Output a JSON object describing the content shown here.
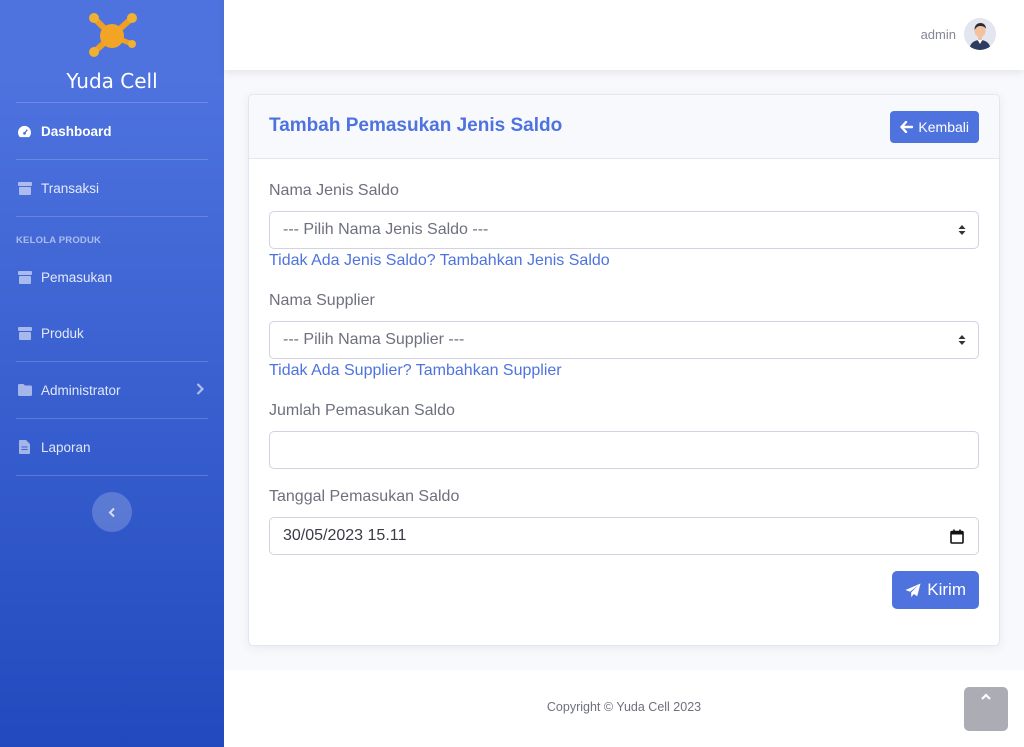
{
  "sidebar": {
    "brand": "Yuda Cell",
    "section_heading": "KELOLA PRODUK",
    "items": [
      {
        "label": "Dashboard",
        "icon": "tachometer-icon"
      },
      {
        "label": "Transaksi",
        "icon": "box-icon"
      },
      {
        "label": "Pemasukan",
        "icon": "box-icon"
      },
      {
        "label": "Produk",
        "icon": "box-icon"
      },
      {
        "label": "Administrator",
        "icon": "folder-icon"
      },
      {
        "label": "Laporan",
        "icon": "file-icon"
      }
    ]
  },
  "topbar": {
    "username": "admin"
  },
  "form": {
    "title": "Tambah Pemasukan Jenis Saldo",
    "back_label": "Kembali",
    "jenis_saldo_label": "Nama Jenis Saldo",
    "jenis_saldo_value": "--- Pilih Nama Jenis Saldo ---",
    "jenis_saldo_link": "Tidak Ada Jenis Saldo? Tambahkan Jenis Saldo",
    "supplier_label": "Nama Supplier",
    "supplier_value": "--- Pilih Nama Supplier ---",
    "supplier_link": "Tidak Ada Supplier? Tambahkan Supplier",
    "jumlah_label": "Jumlah Pemasukan Saldo",
    "jumlah_value": "",
    "tanggal_label": "Tanggal Pemasukan Saldo",
    "tanggal_value": "30/05/2023 15.11",
    "submit_label": "Kirim"
  },
  "footer": {
    "copyright": "Copyright © Yuda Cell 2023"
  },
  "colors": {
    "primary": "#4e73df",
    "sidebar_gradient_end": "#224abe"
  }
}
